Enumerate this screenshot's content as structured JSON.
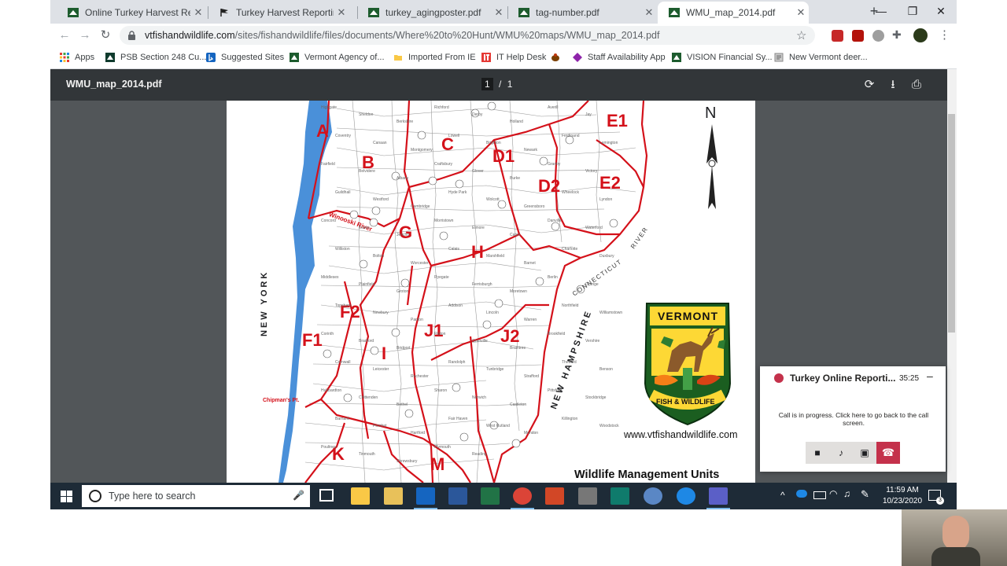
{
  "browser": {
    "tabs": [
      {
        "label": "Online Turkey Harvest Reportin",
        "active": false
      },
      {
        "label": "Turkey Harvest Reporting - VT",
        "active": false
      },
      {
        "label": "turkey_agingposter.pdf",
        "active": false
      },
      {
        "label": "tag-number.pdf",
        "active": false
      },
      {
        "label": "WMU_map_2014.pdf",
        "active": true
      }
    ],
    "url_host": "vtfishandwildlife.com",
    "url_path": "/sites/fishandwildlife/files/documents/Where%20to%20Hunt/WMU%20maps/WMU_map_2014.pdf",
    "bookmarks": [
      {
        "label": "Apps",
        "icon": "apps-grid-icon"
      },
      {
        "label": "PSB Section 248 Cu...",
        "icon": "psb-icon"
      },
      {
        "label": "Suggested Sites",
        "icon": "bing-icon"
      },
      {
        "label": "Vermont Agency of...",
        "icon": "vermont-icon"
      },
      {
        "label": "Imported From IE",
        "icon": "folder-icon"
      },
      {
        "label": "IT Help Desk",
        "icon": "it-icon"
      },
      {
        "label": "",
        "icon": "bug-icon"
      },
      {
        "label": "Staff Availability App",
        "icon": "diamond-icon"
      },
      {
        "label": "VISION Financial Sy...",
        "icon": "vermont-icon"
      },
      {
        "label": "New Vermont deer...",
        "icon": "page-icon"
      }
    ]
  },
  "pdf": {
    "filename": "WMU_map_2014.pdf",
    "page_current": "1",
    "page_sep": "/",
    "page_total": "1",
    "map": {
      "units": [
        "A",
        "B",
        "C",
        "D1",
        "D2",
        "E1",
        "E2",
        "G",
        "H",
        "F2",
        "F1",
        "I",
        "J1",
        "J2",
        "K",
        "M"
      ],
      "north": "N",
      "states": [
        "NEW YORK",
        "NEW HAMPSHIRE"
      ],
      "river_ct": "CONNECTICUT",
      "river_word": "RIVER",
      "winooski": "Winooski River",
      "chipmans": "Chipman's Pt.",
      "logo_top": "VERMONT",
      "logo_bottom": "FISH & WILDLIFE",
      "website": "www.vtfishandwildlife.com",
      "footer": "Wildlife Management Units",
      "towns": [
        "Highgate",
        "Sheldon",
        "Berkshire",
        "Richford",
        "Derby",
        "Holland",
        "Averill",
        "Jay",
        "Coventry",
        "Canaan",
        "Montgomery",
        "Lowell",
        "Brighton",
        "Newark",
        "Ferdinand",
        "Lemington",
        "Fairfield",
        "Belvidere",
        "Albany",
        "Craftsbury",
        "Glover",
        "Burke",
        "Granby",
        "Victory",
        "Guildhall",
        "Westford",
        "Cambridge",
        "Hyde Park",
        "Wolcott",
        "Greensboro",
        "Wheelock",
        "Lyndon",
        "Concord",
        "Essex",
        "Jericho",
        "Morristown",
        "Elmore",
        "Cabot",
        "Danville",
        "Waterford",
        "Williston",
        "Bolton",
        "Worcester",
        "Calais",
        "Marshfield",
        "Barnet",
        "Charlotte",
        "Duxbury",
        "Middlesex",
        "Plainfield",
        "Groton",
        "Ryegate",
        "Ferrisburgh",
        "Moretown",
        "Berlin",
        "Orange",
        "Topsham",
        "Newbury",
        "Panton",
        "Addison",
        "Lincoln",
        "Warren",
        "Northfield",
        "Williamstown",
        "Corinth",
        "Bradford",
        "Bridport",
        "Ripton",
        "Granville",
        "Braintree",
        "Brookfield",
        "Vershire",
        "Cornwall",
        "Leicester",
        "Rochester",
        "Randolph",
        "Tunbridge",
        "Strafford",
        "Thetford",
        "Benson",
        "Hubbardton",
        "Chittenden",
        "Bethel",
        "Sharon",
        "Norwich",
        "Castleton",
        "Pittsford",
        "Stockbridge",
        "Barnard",
        "Pomfret",
        "Hartford",
        "Fair Haven",
        "West Rutland",
        "Mendon",
        "Killington",
        "Woodstock",
        "Poultney",
        "Tinmouth",
        "Shrewsbury",
        "Plymouth",
        "Reading"
      ]
    }
  },
  "call": {
    "title": "Turkey Online Reporti...",
    "duration": "35:25",
    "message": "Call is in progress. Click here to go back to the call screen."
  },
  "taskbar": {
    "search_placeholder": "Type here to search",
    "time": "11:59 AM",
    "date": "10/23/2020",
    "notification_count": "3"
  },
  "colors": {
    "map_red": "#d4111a",
    "water_blue": "#4a90d9",
    "pdf_toolbar": "#323639",
    "pdf_bg": "#525659",
    "taskbar": "#1e2b37",
    "hangup_red": "#c4314b"
  }
}
